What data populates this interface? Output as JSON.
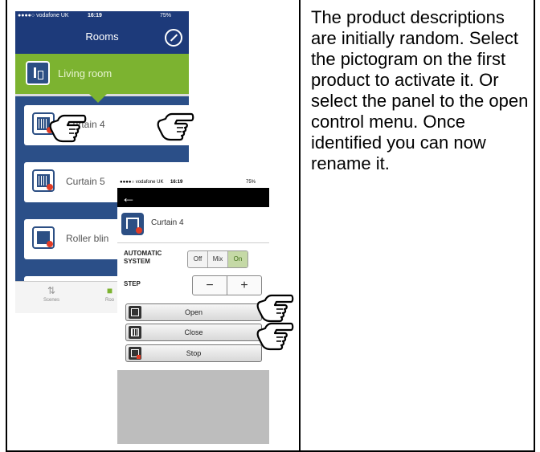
{
  "phone1": {
    "status": {
      "carrier": "●●●●○ vodafone UK",
      "time": "16:19",
      "battery": "75%"
    },
    "header": {
      "title": "Rooms"
    },
    "room": {
      "label": "Living room"
    },
    "products": [
      {
        "label": "Curtain 4"
      },
      {
        "label": "Curtain 5"
      },
      {
        "label": "Roller blin"
      }
    ],
    "tabs": [
      {
        "label": "Scenes"
      },
      {
        "label": "Roo"
      }
    ]
  },
  "phone2": {
    "status": {
      "carrier": "●●●●○ vodafone UK",
      "time": "16:19",
      "battery": "75%"
    },
    "back_glyph": "←",
    "product": {
      "label": "Curtain 4"
    },
    "automatic": {
      "label_line1": "AUTOMATIC",
      "label_line2": "SYSTEM",
      "options": [
        "Off",
        "Mix",
        "On"
      ],
      "selected": "On"
    },
    "step": {
      "label": "STEP",
      "minus": "−",
      "plus": "+"
    },
    "actions": [
      {
        "label": "Open"
      },
      {
        "label": "Close"
      },
      {
        "label": "Stop"
      }
    ]
  },
  "description": "The product descriptions are initially random. Select the pictogram on the first product to activate it. Or select the panel to the open control menu. Once identified you can now rename it.",
  "colors": {
    "nav_blue": "#1d3a7a",
    "room_green": "#7cb330",
    "list_blue": "#2b4f88",
    "accent_red": "#e23b24",
    "on_green": "#c5d9a6"
  }
}
